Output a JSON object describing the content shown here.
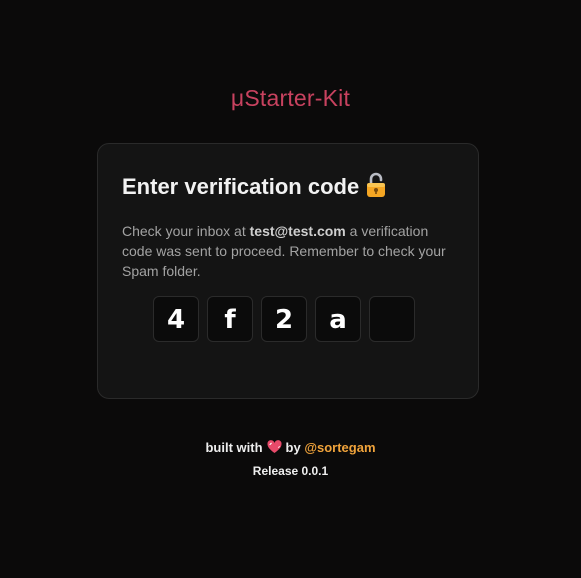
{
  "brand": {
    "title": "μStarter-Kit",
    "color": "#c8425f"
  },
  "card": {
    "title": "Enter verification code",
    "title_icon": "unlocked-padlock-icon",
    "text_before": "Check your inbox at ",
    "email": "test@test.com",
    "text_after": " a verification code was sent to proceed. Remember to check your Spam folder.",
    "code": [
      "4",
      "f",
      "2",
      "a",
      ""
    ]
  },
  "footer": {
    "built_with": "built with",
    "heart_icon": "sparkling-heart-icon",
    "by": "by",
    "author": "@sortegam",
    "author_color": "#f0a33b",
    "release": "Release 0.0.1"
  }
}
